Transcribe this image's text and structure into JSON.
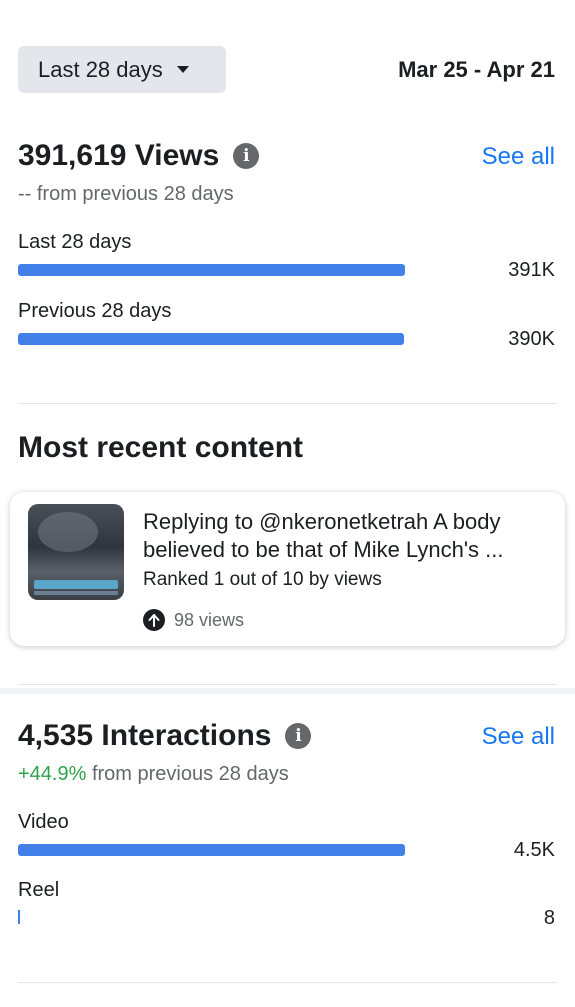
{
  "filter": {
    "range_label": "Last 28 days",
    "date_range": "Mar 25 - Apr 21"
  },
  "views": {
    "title": "391,619 Views",
    "see_all": "See all",
    "compare_text": "-- from previous 28 days",
    "bars": [
      {
        "label": "Last 28 days",
        "value": "391K",
        "fraction": 0.824
      },
      {
        "label": "Previous 28 days",
        "value": "390K",
        "fraction": 0.822
      }
    ]
  },
  "recent": {
    "heading": "Most recent content",
    "card": {
      "title_line1": "Replying to @nkeronetketrah A body",
      "title_line2": "believed to be that of Mike Lynch's ...",
      "rank": "Ranked 1 out of 10 by views",
      "views": "98 views"
    }
  },
  "interactions": {
    "title": "4,535 Interactions",
    "see_all": "See all",
    "compare_change": "+44.9%",
    "compare_text": " from previous 28 days",
    "bars": [
      {
        "label": "Video",
        "value": "4.5K",
        "fraction": 0.824
      },
      {
        "label": "Reel",
        "value": "8",
        "fraction": 0.002
      }
    ]
  },
  "colors": {
    "accent": "#1877f2",
    "bar": "#4080e8",
    "positive": "#31a24c"
  }
}
